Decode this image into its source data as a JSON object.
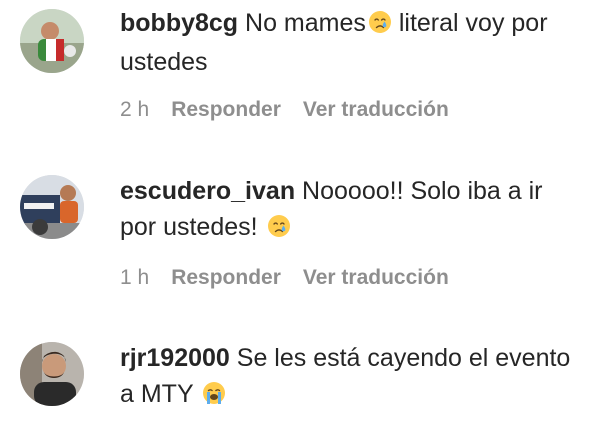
{
  "comments": [
    {
      "username": "bobby8cg",
      "text_before": "No mames",
      "emoji": "crying-face",
      "text_after": " literal voy por ustedes",
      "time": "2 h",
      "reply": "Responder",
      "translate": "Ver traducción"
    },
    {
      "username": "escudero_ivan",
      "text_before": "Nooooo!! Solo iba a ir por ustedes! ",
      "emoji": "crying-face",
      "text_after": "",
      "time": "1 h",
      "reply": "Responder",
      "translate": "Ver traducción"
    },
    {
      "username": "rjr192000",
      "text_before": "Se les está cayendo el evento a MTY ",
      "emoji": "loudly-crying-face",
      "text_after": "",
      "time": "",
      "reply": "",
      "translate": ""
    }
  ],
  "colors": {
    "text": "#262626",
    "secondary": "#8e8e8e",
    "emoji": "#FFCC4D"
  }
}
